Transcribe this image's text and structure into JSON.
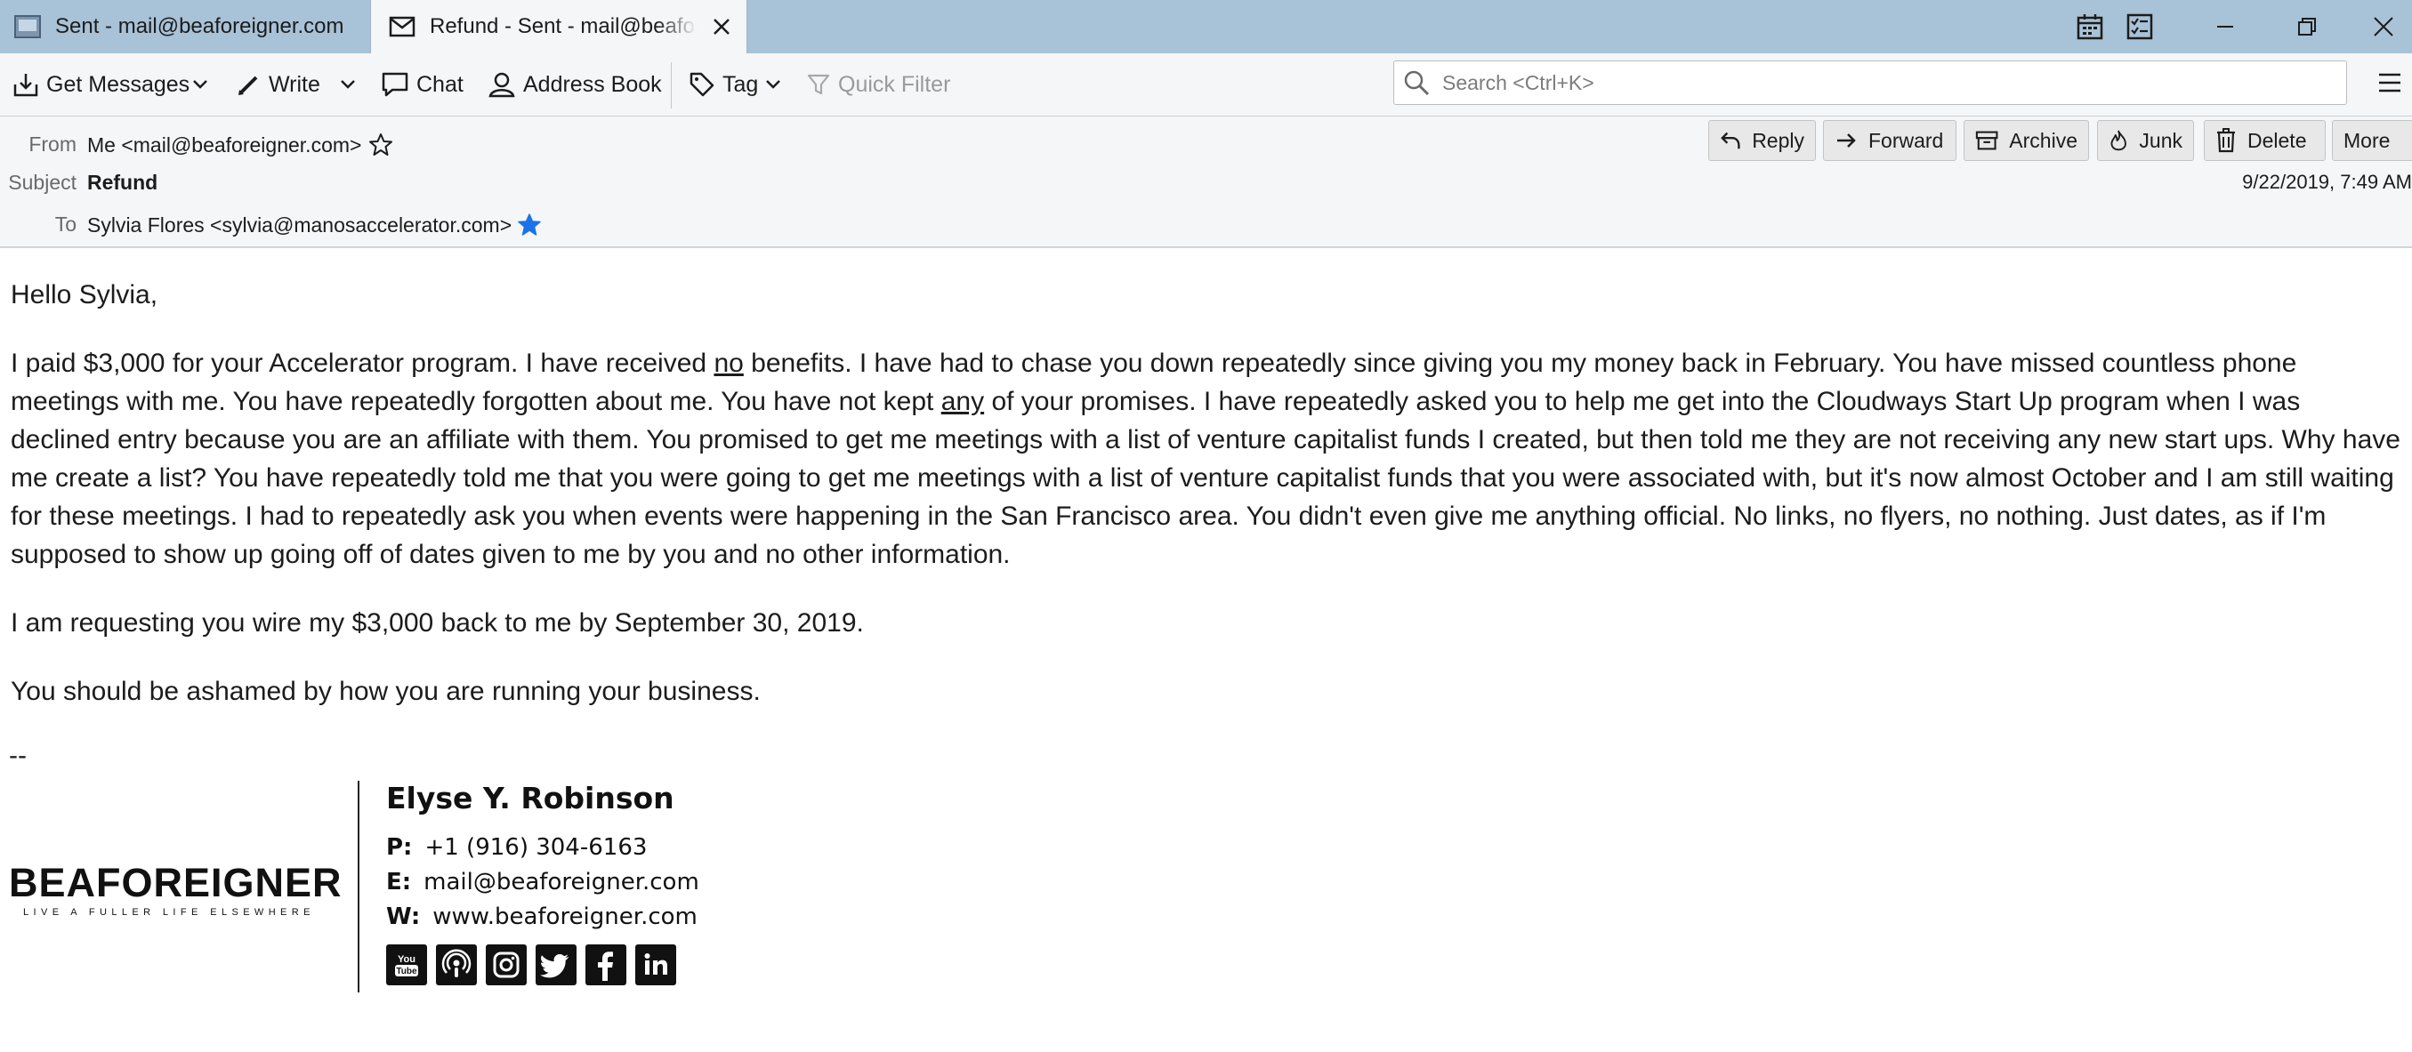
{
  "tabs": [
    {
      "label": "Sent - mail@beaforeigner.com",
      "icon": "mail-folder-icon",
      "active": false
    },
    {
      "label": "Refund - Sent - mail@beaforeigner.com",
      "icon": "envelope-icon",
      "active": true
    }
  ],
  "window_controls": {
    "calendar": "calendar-icon",
    "tasks": "tasks-icon",
    "minimize": "minimize-icon",
    "restore": "restore-icon",
    "close": "close-icon"
  },
  "toolbar": {
    "get_messages": "Get Messages",
    "write": "Write",
    "chat": "Chat",
    "address_book": "Address Book",
    "tag": "Tag",
    "quick_filter": "Quick Filter",
    "search_placeholder": "Search <Ctrl+K>"
  },
  "header": {
    "from_label": "From",
    "from_value": "Me <mail@beaforeigner.com>",
    "subject_label": "Subject",
    "subject_value": "Refund",
    "to_label": "To",
    "to_value": "Sylvia Flores <sylvia@manosaccelerator.com>",
    "date": "9/22/2019, 7:49 AM",
    "buttons": {
      "reply": "Reply",
      "forward": "Forward",
      "archive": "Archive",
      "junk": "Junk",
      "delete": "Delete",
      "more": "More"
    }
  },
  "message": {
    "greeting": "Hello Sylvia,",
    "p1_a": "I paid $3,000 for your Accelerator program. I have received ",
    "p1_no": "no",
    "p1_b": " benefits. I have had to chase you down repeatedly since giving you my money back in February. You have missed countless phone meetings with me. You have repeatedly forgotten about me. You have not kept ",
    "p1_any": "any",
    "p1_c": " of your promises. I have repeatedly asked you to help me get into the Cloudways Start Up program when I was declined entry because you are an affiliate with them. You promised to get me meetings with a list of venture capitalist funds I created, but then told me they are not receiving any new start ups. Why have me create a list? You have repeatedly told me that you were going to get me meetings with a list of venture capitalist funds that you were associated with, but it's now almost October and I am still waiting for these meetings. I had to repeatedly ask you when events were happening in the San Francisco area. You didn't even give me anything official. No links, no flyers, no nothing. Just dates, as if I'm supposed to show up going off of dates given to me by you and no other information.",
    "p2": "I am requesting you wire my $3,000 back to me by September 30, 2019.",
    "p3": "You should be ashamed by how you are running your business.",
    "sig_dash": "--"
  },
  "signature": {
    "logo_main": "BEAFOREIGNER",
    "logo_tag": "LIVE A FULLER LIFE ELSEWHERE",
    "name": "Elyse Y. Robinson",
    "phone_label": "P:",
    "phone": "+1 (916) 304-6163",
    "email_label": "E:",
    "email": "mail@beaforeigner.com",
    "web_label": "W:",
    "web": "www.beaforeigner.com",
    "social": [
      "youtube-icon",
      "podcast-icon",
      "instagram-icon",
      "twitter-icon",
      "facebook-icon",
      "linkedin-icon"
    ]
  },
  "colors": {
    "titlebar": "#a8c2d7",
    "toolbar": "#f5f6f7",
    "star_blue": "#1a73e8"
  }
}
